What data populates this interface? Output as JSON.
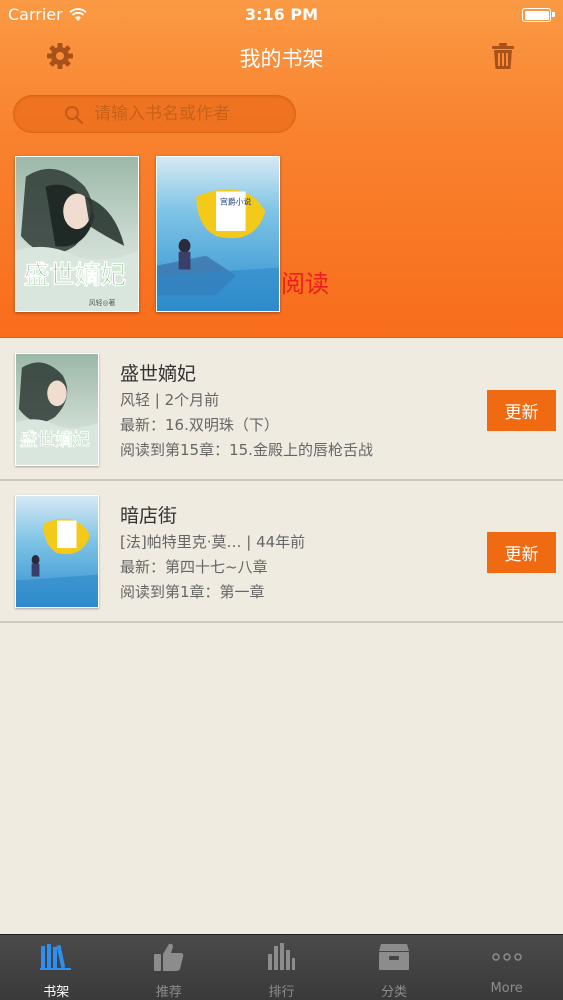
{
  "status_bar": {
    "carrier": "Carrier",
    "time": "3:16 PM"
  },
  "nav": {
    "title": "我的书架",
    "settings_icon": "gear-icon",
    "trash_icon": "trash-icon"
  },
  "search": {
    "placeholder": "请输入书名或作者",
    "value": ""
  },
  "shelf": {
    "read_label": "阅读",
    "covers": [
      {
        "title": "盛世嫡妃",
        "author": "风轻"
      },
      {
        "title": "暗店街"
      }
    ]
  },
  "books": [
    {
      "title": "盛世嫡妃",
      "author_time": "风轻 | 2个月前",
      "latest": "最新：16.双明珠（下）",
      "progress": "阅读到第15章：15.金殿上的唇枪舌战",
      "button": "更新"
    },
    {
      "title": "暗店街",
      "author_time": "[法]帕特里克·莫…  | 44年前",
      "latest": "最新：第四十七~八章",
      "progress": "阅读到第1章：第一章",
      "button": "更新"
    }
  ],
  "tabs": [
    {
      "label": "书架",
      "icon": "bookshelf-icon",
      "active": true
    },
    {
      "label": "推荐",
      "icon": "thumbs-up-icon",
      "active": false
    },
    {
      "label": "排行",
      "icon": "bar-chart-icon",
      "active": false
    },
    {
      "label": "分类",
      "icon": "box-icon",
      "active": false
    },
    {
      "label": "More",
      "icon": "more-dots-icon",
      "active": false
    }
  ],
  "colors": {
    "accent": "#f06a12",
    "header_top": "#fb9a44",
    "header_bottom": "#f86d1b",
    "background": "#f0ebe1",
    "tab_active": "#2e8ff0",
    "read_label": "#ee1d1d"
  }
}
